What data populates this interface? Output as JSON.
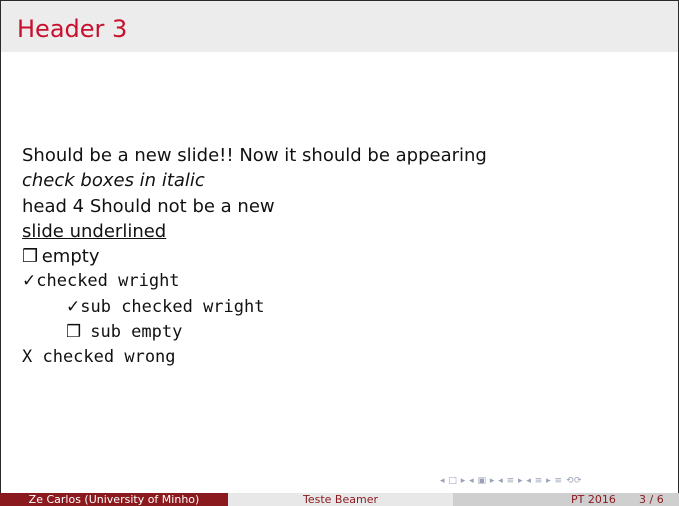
{
  "slide": {
    "title": "Header 3",
    "lines": {
      "l1": "Should be a new slide!! Now it should be appearing",
      "l2": "check boxes in italic",
      "l3": "head 4 Should not be a new",
      "l4": "slide underlined",
      "l5_box": "❒",
      "l5_text": " empty",
      "l6_check": "✓",
      "l6_text": "checked wright",
      "l7_check": "✓",
      "l7_text": "sub checked wright",
      "l8_box": "❒",
      "l8_text": " sub empty",
      "l9": "X checked wrong"
    }
  },
  "nav": {
    "symbols": "◂ □ ▸ ◂ ▣ ▸ ◂ ≡ ▸ ◂ ≡ ▸   ≡   ⟲⟳"
  },
  "footer": {
    "author": "Ze Carlos  (University of Minho)",
    "title": "Teste Beamer",
    "conference": "PT 2016",
    "page": "3 / 6"
  },
  "colors": {
    "title": "#c8102e",
    "footer_left": "#8b1a1f"
  }
}
